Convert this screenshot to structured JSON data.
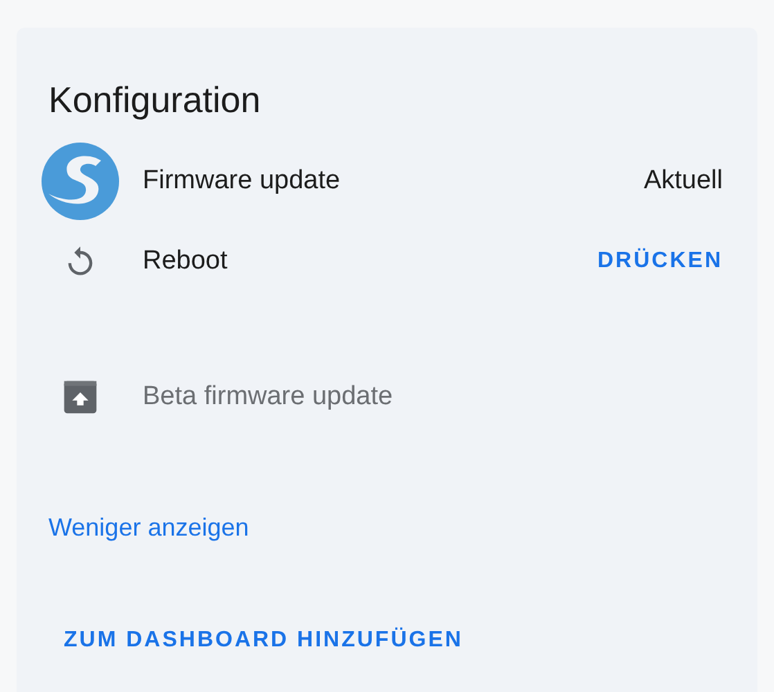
{
  "card": {
    "title": "Konfiguration",
    "rows": [
      {
        "kind": "logo",
        "label": "Firmware update",
        "value": "Aktuell",
        "disabled": false
      },
      {
        "kind": "restart",
        "label": "Reboot",
        "action": "DRÜCKEN",
        "disabled": false
      },
      {
        "kind": "archive",
        "label": "Beta firmware update",
        "disabled": true
      }
    ],
    "toggle_link": "Weniger anzeigen",
    "add_button": "ZUM DASHBOARD HINZUFÜGEN"
  }
}
